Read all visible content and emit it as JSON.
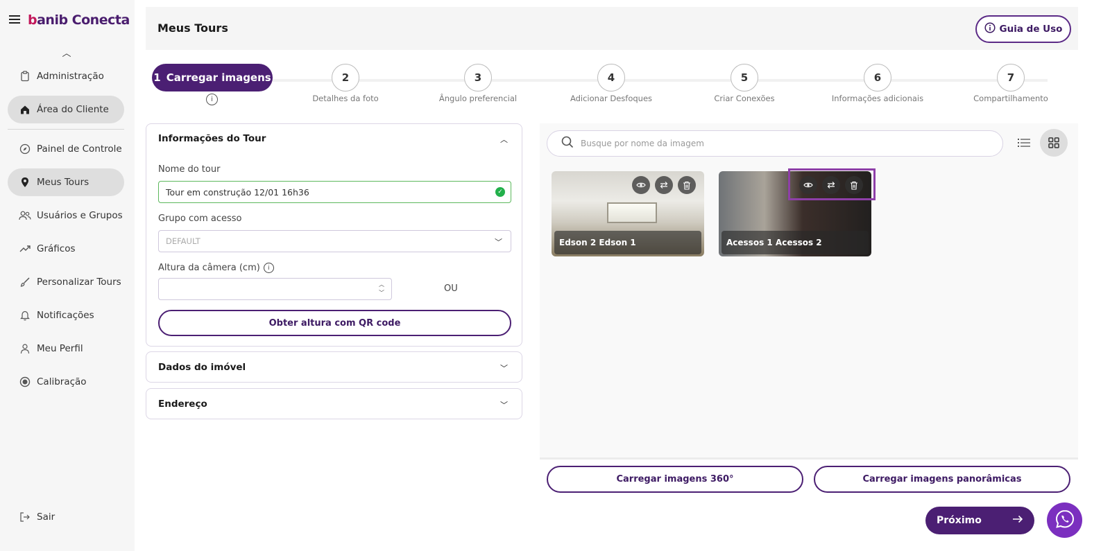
{
  "sidebar": {
    "logo_prefix": "b",
    "logo_text": "anib Conecta",
    "items": [
      {
        "label": "Administração",
        "icon": "clipboard-icon"
      },
      {
        "label": "Área do Cliente",
        "icon": "home-icon",
        "active": true
      },
      {
        "label": "Painel de Controle",
        "icon": "compass-icon"
      },
      {
        "label": "Meus Tours",
        "icon": "map-pin-icon",
        "active": true
      },
      {
        "label": "Usuários e Grupos",
        "icon": "users-icon"
      },
      {
        "label": "Gráficos",
        "icon": "trend-icon"
      },
      {
        "label": "Personalizar Tours",
        "icon": "brush-icon"
      },
      {
        "label": "Notificações",
        "icon": "bell-icon"
      },
      {
        "label": "Meu Perfil",
        "icon": "user-icon"
      },
      {
        "label": "Calibração",
        "icon": "target-icon"
      }
    ],
    "logout": "Sair"
  },
  "header": {
    "title": "Meus Tours",
    "guide_button": "Guia de Uso"
  },
  "stepper": {
    "active": {
      "number": "1",
      "label": "Carregar imagens"
    },
    "steps": [
      {
        "number": "2",
        "label": "Detalhes da foto"
      },
      {
        "number": "3",
        "label": "Ângulo preferencial"
      },
      {
        "number": "4",
        "label": "Adicionar Desfoques"
      },
      {
        "number": "5",
        "label": "Criar Conexões"
      },
      {
        "number": "6",
        "label": "Informações adicionais"
      },
      {
        "number": "7",
        "label": "Compartilhamento"
      }
    ]
  },
  "tour_info": {
    "title": "Informações do Tour",
    "name_label": "Nome do tour",
    "name_value": "Tour em construção 12/01 16h36",
    "group_label": "Grupo com acesso",
    "group_value": "DEFAULT",
    "camera_label": "Altura da câmera (cm)",
    "camera_value": "",
    "or_text": "OU",
    "qr_button": "Obter altura com QR code"
  },
  "property_data": {
    "title": "Dados do imóvel"
  },
  "address": {
    "title": "Endereço"
  },
  "gallery": {
    "search_placeholder": "Busque por nome da imagem",
    "images": [
      {
        "caption": "Edson 2 Edson 1"
      },
      {
        "caption": "Acessos 1 Acessos 2"
      }
    ]
  },
  "actions": {
    "upload_360": "Carregar imagens 360°",
    "upload_panoramic": "Carregar imagens panorâmicas",
    "next": "Próximo"
  },
  "colors": {
    "brand": "#4b1f73",
    "accent_highlight": "#8e3fa8",
    "whatsapp_button": "#7b2fbf",
    "valid": "#22b04b"
  }
}
